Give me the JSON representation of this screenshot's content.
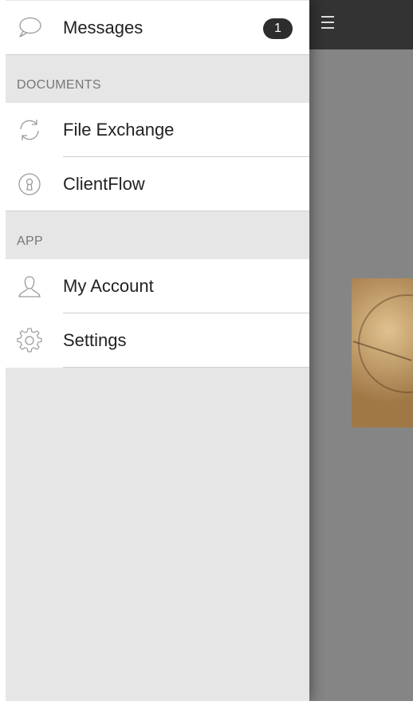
{
  "drawer": {
    "messages": {
      "label": "Messages",
      "badge": "1",
      "icon": "speech-bubble-icon"
    },
    "sections": {
      "documents": {
        "title": "DOCUMENTS"
      },
      "app": {
        "title": "APP"
      }
    },
    "items": {
      "file_exchange": {
        "label": "File Exchange",
        "icon": "sync-icon"
      },
      "clientflow": {
        "label": "ClientFlow",
        "icon": "keyhole-icon"
      },
      "my_account": {
        "label": "My Account",
        "icon": "user-icon"
      },
      "settings": {
        "label": "Settings",
        "icon": "gear-icon"
      }
    }
  },
  "main": {
    "menu_icon": "hamburger-icon"
  },
  "colors": {
    "topbar": "#333333",
    "badge": "#2d2d2d",
    "drawer_bg": "#e6e6e6",
    "main_overlay": "#858585"
  }
}
